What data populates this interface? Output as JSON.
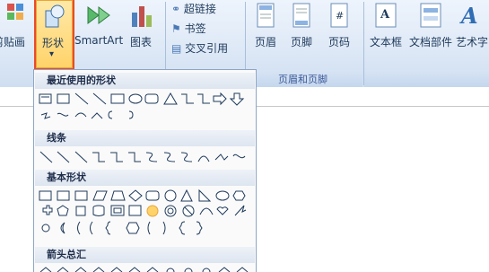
{
  "ribbon": {
    "paste_special_label": "剪贴画",
    "shapes_label": "形状",
    "shapes_dropdown": "▾",
    "smartart_label": "SmartArt",
    "chart_label": "图表",
    "hyperlink_label": "超链接",
    "bookmark_label": "书签",
    "crossref_label": "交叉引用",
    "header_label": "页眉",
    "footer_label": "页脚",
    "pagenum_label": "页码",
    "header_footer_group": "页眉和页脚",
    "textbox_label": "文本框",
    "quickparts_label": "文档部件",
    "wordart_label": "艺术字"
  },
  "shapes_menu": {
    "recent_title": "最近使用的形状",
    "lines_title": "线条",
    "basic_title": "基本形状",
    "arrows_title": "箭头总汇"
  },
  "colors": {
    "ribbon_text": "#1e395b",
    "highlight_border": "#e84b2a",
    "selected_fill": "#ffd36a"
  }
}
